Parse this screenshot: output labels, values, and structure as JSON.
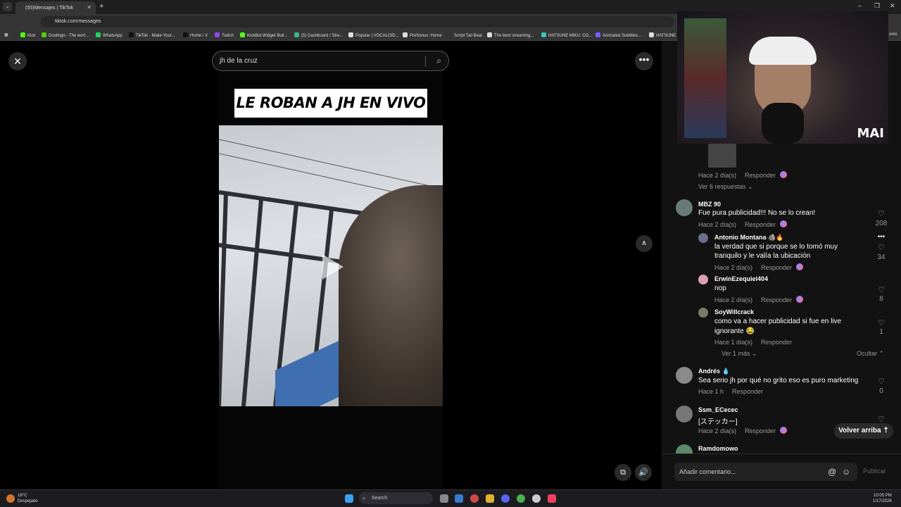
{
  "browser": {
    "tab_title": "(55)Mensajes | TikTok",
    "url": "tiktok.com/messages",
    "bookmarks": [
      {
        "label": "Kick",
        "color": "#53fc18"
      },
      {
        "label": "Duolingo - The worl...",
        "color": "#58cc02"
      },
      {
        "label": "WhatsApp",
        "color": "#25d366"
      },
      {
        "label": "TikTok - Make Your...",
        "color": "#111111"
      },
      {
        "label": "Home / X",
        "color": "#111111"
      },
      {
        "label": "Twitch",
        "color": "#9146ff"
      },
      {
        "label": "KickBot Widget Buil...",
        "color": "#53fc18"
      },
      {
        "label": "(5) Dashboard / Stre...",
        "color": "#3fb68b"
      },
      {
        "label": "Popular | VOCALOID...",
        "color": "#dddddd"
      },
      {
        "label": "PreSonus: Home",
        "color": "#dddddd"
      },
      {
        "label": "Script Tail Beat",
        "color": "#333333"
      },
      {
        "label": "The best streaming...",
        "color": "#dddddd"
      },
      {
        "label": "HATSUNE MIKU: CO...",
        "color": "#39c5bb"
      },
      {
        "label": "Animated Subtitles...",
        "color": "#7a5cff"
      },
      {
        "label": "HATSUNE M",
        "color": "#dddddd"
      }
    ],
    "bookmarks_overflow": "ores"
  },
  "player": {
    "close_icon": "×",
    "search_value": "jh de la cruz",
    "more_icon": "•••",
    "video_title": "LE ROBAN A JH EN VIVO",
    "up_icon": "∧"
  },
  "comments": [
    {
      "id": "c0",
      "meta": "Hace 2 día(s)",
      "reply": "Responder",
      "expand": "Ver 6 respuestas"
    },
    {
      "id": "c1",
      "user": "MBZ 90",
      "text": "Fue pura publicidad!!! No se lo crean!",
      "meta": "Hace 2 día(s)",
      "reply": "Responder",
      "likes": "208"
    },
    {
      "id": "r1",
      "user": "Antonio Montana",
      "text1": "la verdad que si porque se lo tomó muy",
      "text2": "tranquilo y le valía la ubicación",
      "meta": "Hace 2 día(s)",
      "reply": "Responder",
      "likes": "34"
    },
    {
      "id": "r2",
      "user": "ErwinEzequiel404",
      "text": "nop",
      "meta": "Hace 2 día(s)",
      "reply": "Responder",
      "likes": "8"
    },
    {
      "id": "r3",
      "user": "SoyWillcrack",
      "text1": "como va a hacer publicidad si fue en live",
      "text2": "ignorante",
      "meta": "Hace 1 día(s)",
      "reply": "Responder",
      "likes": "1"
    },
    {
      "id": "more",
      "expand": "Ver 1 más",
      "hide": "Ocultar"
    },
    {
      "id": "c2",
      "user": "Andrés",
      "text": "Sea serio jh por qué no grito eso es puro marketing",
      "meta": "Hace 1 h",
      "reply": "Responder",
      "likes": "0"
    },
    {
      "id": "c3",
      "user": "Ssm_ECecec",
      "text": "[ステッカー]",
      "meta": "Hace 2 día(s)",
      "reply": "Responder"
    },
    {
      "id": "c4",
      "user": "Ramdomowo"
    }
  ],
  "panel": {
    "volver_label": "Volver arriba",
    "comment_placeholder": "Añadir comentario...",
    "publish_label": "Publicar",
    "cam_overlay": "MAI"
  },
  "taskbar": {
    "temp": "18°C",
    "weather": "Despejado",
    "search_placeholder": "Search",
    "time": "10:05 PM",
    "date": "1/17/2026"
  }
}
